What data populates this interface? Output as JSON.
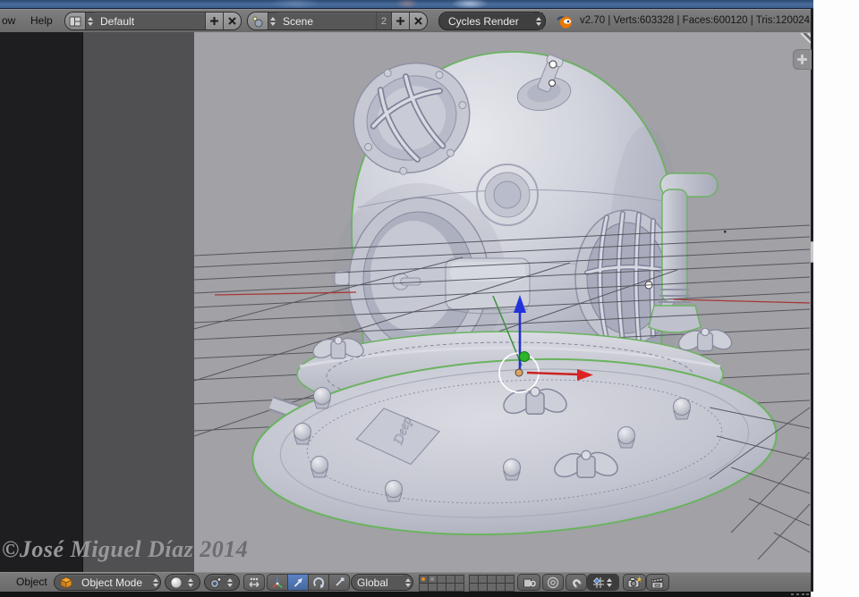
{
  "header": {
    "menu_window_partial": "ow",
    "menu_help": "Help",
    "layout_field": "Default",
    "scene_field": "Scene",
    "scene_user_count": "2",
    "engine_selector": "Cycles Render",
    "stats": "v2.70 | Verts:603328 | Faces:600120 | Tris:120024"
  },
  "toolbar": {
    "object_menu": "Object",
    "mode_selector": "Object Mode",
    "orientation_selector": "Global"
  },
  "viewport": {
    "watermark": "©José Miguel Díaz 2014",
    "plaque_text": "Deep"
  },
  "colors": {
    "selection_outline": "#6ab35f",
    "axis_x": "#a83636",
    "axis_y": "#3f8f3f",
    "gizmo_z_arrow": "#2233cc",
    "gizmo_x_arrow": "#cc2222",
    "gizmo_y_ball": "#2bb52b",
    "origin_dot": "#d9a465",
    "active_layer_dot": "#e08e2d",
    "titlebar_blue": "#4a6d9c",
    "viewport_bg": "#a1a1a6"
  }
}
